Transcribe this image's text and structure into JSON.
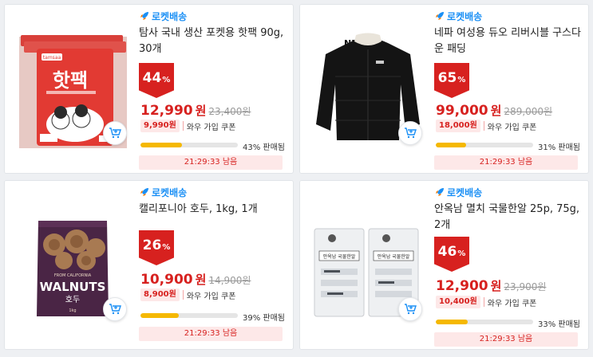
{
  "products": [
    {
      "delivery_label": "로켓배송",
      "title": "탐사 국내 생산 포켓용 핫팩 90g, 30개",
      "discount": "44",
      "pct_symbol": "%",
      "price": "12,990",
      "currency": "원",
      "original_price": "23,400원",
      "coupon_price": "9,990원",
      "coupon_text": "와우 가입 쿠폰",
      "sold_percent": 43,
      "sold_text": "43% 판매됨",
      "timer": "21:29:33 남음",
      "image": {
        "brand": "tamsaa",
        "name": "핫팩"
      }
    },
    {
      "delivery_label": "로켓배송",
      "title": "네파 여성용 듀오 리버시블 구스다운 패딩",
      "discount": "65",
      "pct_symbol": "%",
      "price": "99,000",
      "currency": "원",
      "original_price": "289,000원",
      "coupon_price": "18,000원",
      "coupon_text": "와우 가입 쿠폰",
      "sold_percent": 31,
      "sold_text": "31% 판매됨",
      "timer": "21:29:33 남음",
      "image": {
        "brand": "NEPA"
      }
    },
    {
      "delivery_label": "로켓배송",
      "title": "캘리포니아 호두, 1kg, 1개",
      "discount": "26",
      "pct_symbol": "%",
      "price": "10,900",
      "currency": "원",
      "original_price": "14,900원",
      "coupon_price": "8,900원",
      "coupon_text": "와우 가입 쿠폰",
      "sold_percent": 39,
      "sold_text": "39% 판매됨",
      "timer": "21:29:33 남음",
      "image": {
        "top": "FROM CALIFORNIA",
        "name": "WALNUTS",
        "kor": "호두",
        "weight": "1kg"
      }
    },
    {
      "delivery_label": "로켓배송",
      "title": "안옥남 멸치 국물한알 25p, 75g, 2개",
      "discount": "46",
      "pct_symbol": "%",
      "price": "12,900",
      "currency": "원",
      "original_price": "23,900원",
      "coupon_price": "10,400원",
      "coupon_text": "와우 가입 쿠폰",
      "sold_percent": 33,
      "sold_text": "33% 판매됨",
      "timer": "21:29:33 남음",
      "image": {
        "name": "안옥남 국물한알"
      }
    }
  ],
  "colors": {
    "accent_red": "#d7211f",
    "rocket_blue": "#1a8ff5",
    "progress_yellow": "#f5b800",
    "coupon_bg": "#fde8e8"
  },
  "icons": {
    "delivery": "rocket-icon",
    "cart": "cart-plus-icon"
  }
}
